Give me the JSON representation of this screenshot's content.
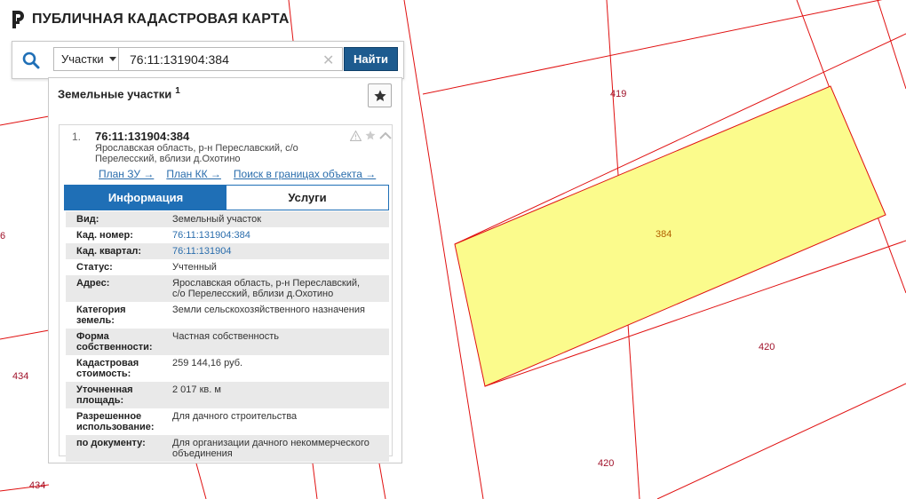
{
  "app": {
    "title": "ПУБЛИЧНАЯ КАДАСТРОВАЯ КАРТА"
  },
  "search": {
    "type_label": "Участки",
    "value": "76:11:131904:384",
    "find_label": "Найти"
  },
  "panel": {
    "title": "Земельные участки",
    "count": "1"
  },
  "result": {
    "index": "1.",
    "cad_number": "76:11:131904:384",
    "address": "Ярославская область, р-н Переславский, с/о Перелесский, вблизи д.Охотино",
    "links": [
      "План ЗУ →",
      "План КК →",
      "Поиск в границах объекта →"
    ]
  },
  "tabs": [
    "Информация",
    "Услуги"
  ],
  "attributes": [
    {
      "label": "Вид:",
      "value": "Земельный участок"
    },
    {
      "label": "Кад. номер:",
      "value": "76:11:131904:384",
      "link": true
    },
    {
      "label": "Кад. квартал:",
      "value": "76:11:131904",
      "link": true
    },
    {
      "label": "Статус:",
      "value": "Учтенный"
    },
    {
      "label": "Адрес:",
      "value": "Ярославская область, р-н Переславский, с/о Перелесский, вблизи д.Охотино"
    },
    {
      "label": "Категория земель:",
      "value": "Земли сельскохозяйственного назначения"
    },
    {
      "label": "Форма собственности:",
      "value": "Частная собственность"
    },
    {
      "label": "Кадастровая стоимость:",
      "value": "259 144,16 руб."
    },
    {
      "label": "Уточненная площадь:",
      "value": "2 017 кв. м"
    },
    {
      "label": "Разрешенное использование:",
      "value": "Для дачного строительства"
    },
    {
      "label": "по документу:",
      "value": "Для организации дачного некоммерческого объединения"
    }
  ],
  "map_labels": {
    "p419": "419",
    "p384": "384",
    "p420a": "420",
    "p420b": "420",
    "p434a": "434",
    "p434b": "434",
    "p6": "6"
  },
  "colors": {
    "parcel_border": "#e01010",
    "selected_fill": "#fbfb8c",
    "accent": "#1f6fb6",
    "button": "#1d5b8f"
  },
  "icons": {
    "search": "search-icon",
    "star": "star-icon",
    "warning": "warning-icon",
    "collapse": "chevron-up-icon",
    "logo": "logo-icon"
  }
}
